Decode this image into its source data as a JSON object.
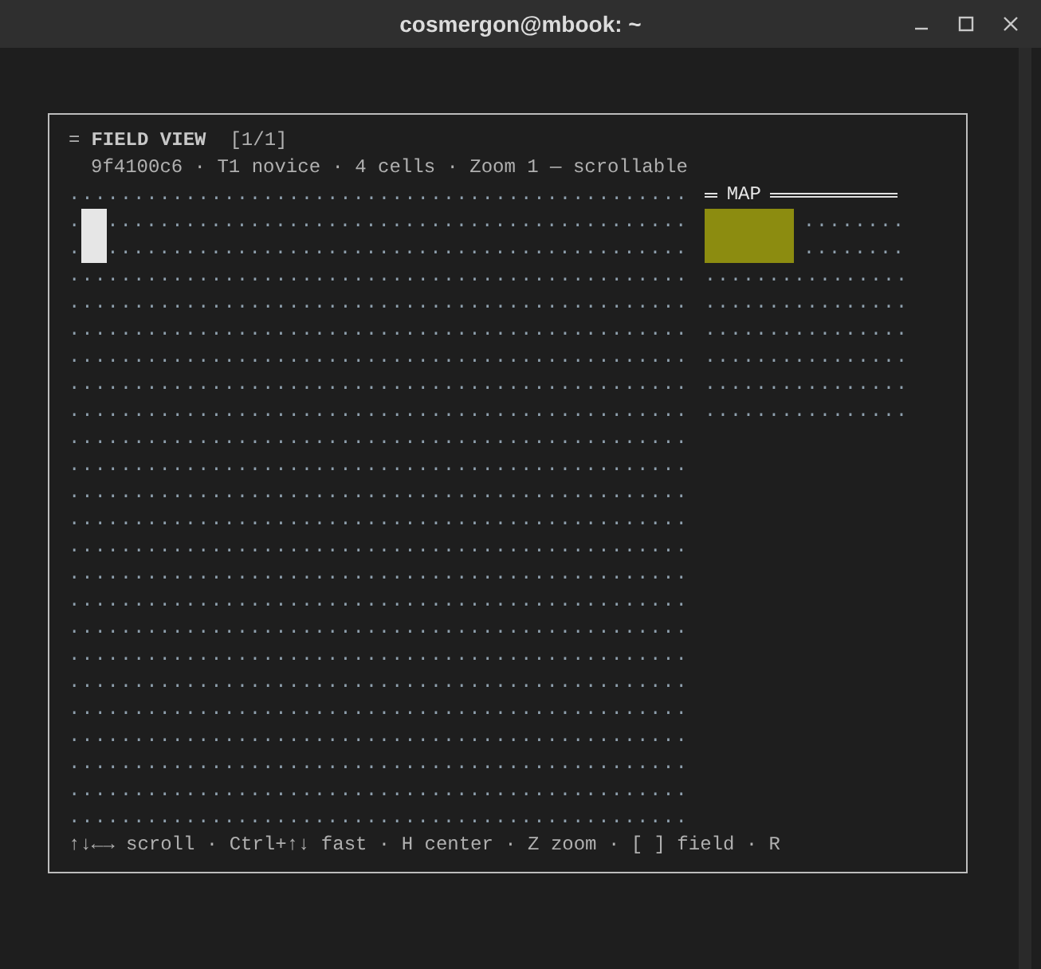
{
  "window": {
    "title": "cosmergon@mbook: ~"
  },
  "panel": {
    "prefix": "=",
    "title": "FIELD VIEW",
    "page": "[1/1]",
    "subtitle": "9f4100c6 · T1 novice · 4 cells · Zoom 1 — scrollable",
    "field_rows": [
      {
        "cursor": false,
        "cells": "................................................"
      },
      {
        "cursor": true,
        "lead": ".",
        "cells": "............................................."
      },
      {
        "cursor": true,
        "lead": ".",
        "cells": "............................................."
      },
      {
        "cursor": false,
        "cells": "................................................"
      },
      {
        "cursor": false,
        "cells": "................................................"
      },
      {
        "cursor": false,
        "cells": "................................................"
      },
      {
        "cursor": false,
        "cells": "................................................"
      },
      {
        "cursor": false,
        "cells": "................................................"
      },
      {
        "cursor": false,
        "cells": "................................................"
      },
      {
        "cursor": false,
        "cells": "................................................"
      },
      {
        "cursor": false,
        "cells": "................................................"
      },
      {
        "cursor": false,
        "cells": "................................................"
      },
      {
        "cursor": false,
        "cells": "................................................"
      },
      {
        "cursor": false,
        "cells": "................................................"
      },
      {
        "cursor": false,
        "cells": "................................................"
      },
      {
        "cursor": false,
        "cells": "................................................"
      },
      {
        "cursor": false,
        "cells": "................................................"
      },
      {
        "cursor": false,
        "cells": "................................................"
      },
      {
        "cursor": false,
        "cells": "................................................"
      },
      {
        "cursor": false,
        "cells": "................................................"
      },
      {
        "cursor": false,
        "cells": "................................................"
      },
      {
        "cursor": false,
        "cells": "................................................"
      },
      {
        "cursor": false,
        "cells": "................................................"
      },
      {
        "cursor": false,
        "cells": "................................................"
      }
    ],
    "map": {
      "title": "MAP",
      "rows": [
        {
          "block": true,
          "color": "#8c8c10",
          "cells": "........"
        },
        {
          "block": true,
          "color": "#8c8c10",
          "cells": "........"
        },
        {
          "block": false,
          "cells": "................"
        },
        {
          "block": false,
          "cells": "................"
        },
        {
          "block": false,
          "cells": "................"
        },
        {
          "block": false,
          "cells": "................"
        },
        {
          "block": false,
          "cells": "................"
        },
        {
          "block": false,
          "cells": "................"
        }
      ]
    },
    "hint": "↑↓←→ scroll · Ctrl+↑↓ fast · H center · Z zoom · [ ] field · R"
  }
}
